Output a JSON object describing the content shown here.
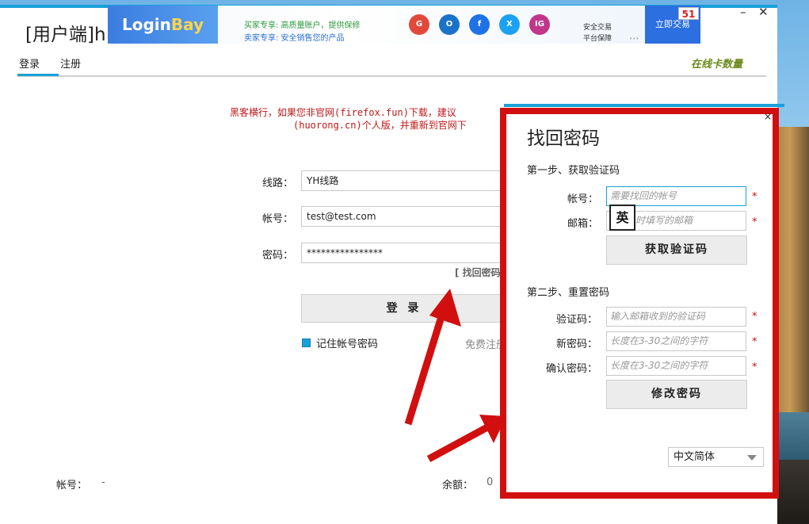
{
  "window": {
    "title": "[用户端]h",
    "minimize_glyph": "–",
    "close_glyph": "✕"
  },
  "banner": {
    "logo_a": "Login",
    "logo_b": "Bay",
    "buyer_line": "买家专享: 高质量账户，提供保修",
    "seller_line": "卖家专享: 安全销售您的产品",
    "icons": [
      {
        "name": "google-icon",
        "glyph": "G",
        "color": "#e2493a"
      },
      {
        "name": "outlook-icon",
        "glyph": "O",
        "color": "#1a73c9"
      },
      {
        "name": "facebook-icon",
        "glyph": "f",
        "color": "#1e72e6"
      },
      {
        "name": "x-icon",
        "glyph": "X",
        "color": "#1da1f2"
      },
      {
        "name": "instagram-icon",
        "glyph": "IG",
        "color": "#c1358a"
      }
    ],
    "safe_1": "安全交易",
    "safe_2": "平台保障",
    "dots": "•••",
    "trade_button": "立即交易",
    "trade_badge": "51"
  },
  "tabs": {
    "login": "登录",
    "register": "注册"
  },
  "online_count": "在线卡数量",
  "warning_line1": "黑客横行，如果您非官网(firefox.fun)下载，建议",
  "warning_line2": "(huorong.cn)个人版，并重新到官网下",
  "login_form": {
    "line_label": "线路：",
    "line_value": "YH线路",
    "account_label": "帐号：",
    "account_value": "test@test.com",
    "password_label": "密码：",
    "password_value": "****************",
    "forgot_link": "[ 找回密码",
    "login_button": "登 录",
    "remember_label": "记住帐号密码",
    "free_register": "免费注册"
  },
  "status_bar": {
    "account_label": "帐号：",
    "account_value": "-",
    "balance_label": "余额：",
    "balance_value": "0"
  },
  "dialog": {
    "close_glyph": "×",
    "title": "找回密码",
    "step1": "第一步、获取验证码",
    "account_label": "帐号：",
    "account_placeholder": "需要找回的帐号",
    "email_label": "邮箱：",
    "email_placeholder": "时填写的邮箱",
    "required": "*",
    "get_code_button": "获取验证码",
    "step2": "第二步、重置密码",
    "code_label": "验证码：",
    "code_placeholder": "输入邮箱收到的验证码",
    "new_pwd_label": "新密码：",
    "new_pwd_placeholder": "长度在3-30之间的字符",
    "confirm_pwd_label": "确认密码：",
    "confirm_pwd_placeholder": "长度在3-30之间的字符",
    "change_button": "修改密码",
    "ime_indicator": "英",
    "language": "中文简体"
  },
  "colors": {
    "accent": "#1aa0d8",
    "highlight_red": "#d10f0f",
    "warning_red": "#c01818",
    "online_green": "#6b8a1c"
  }
}
